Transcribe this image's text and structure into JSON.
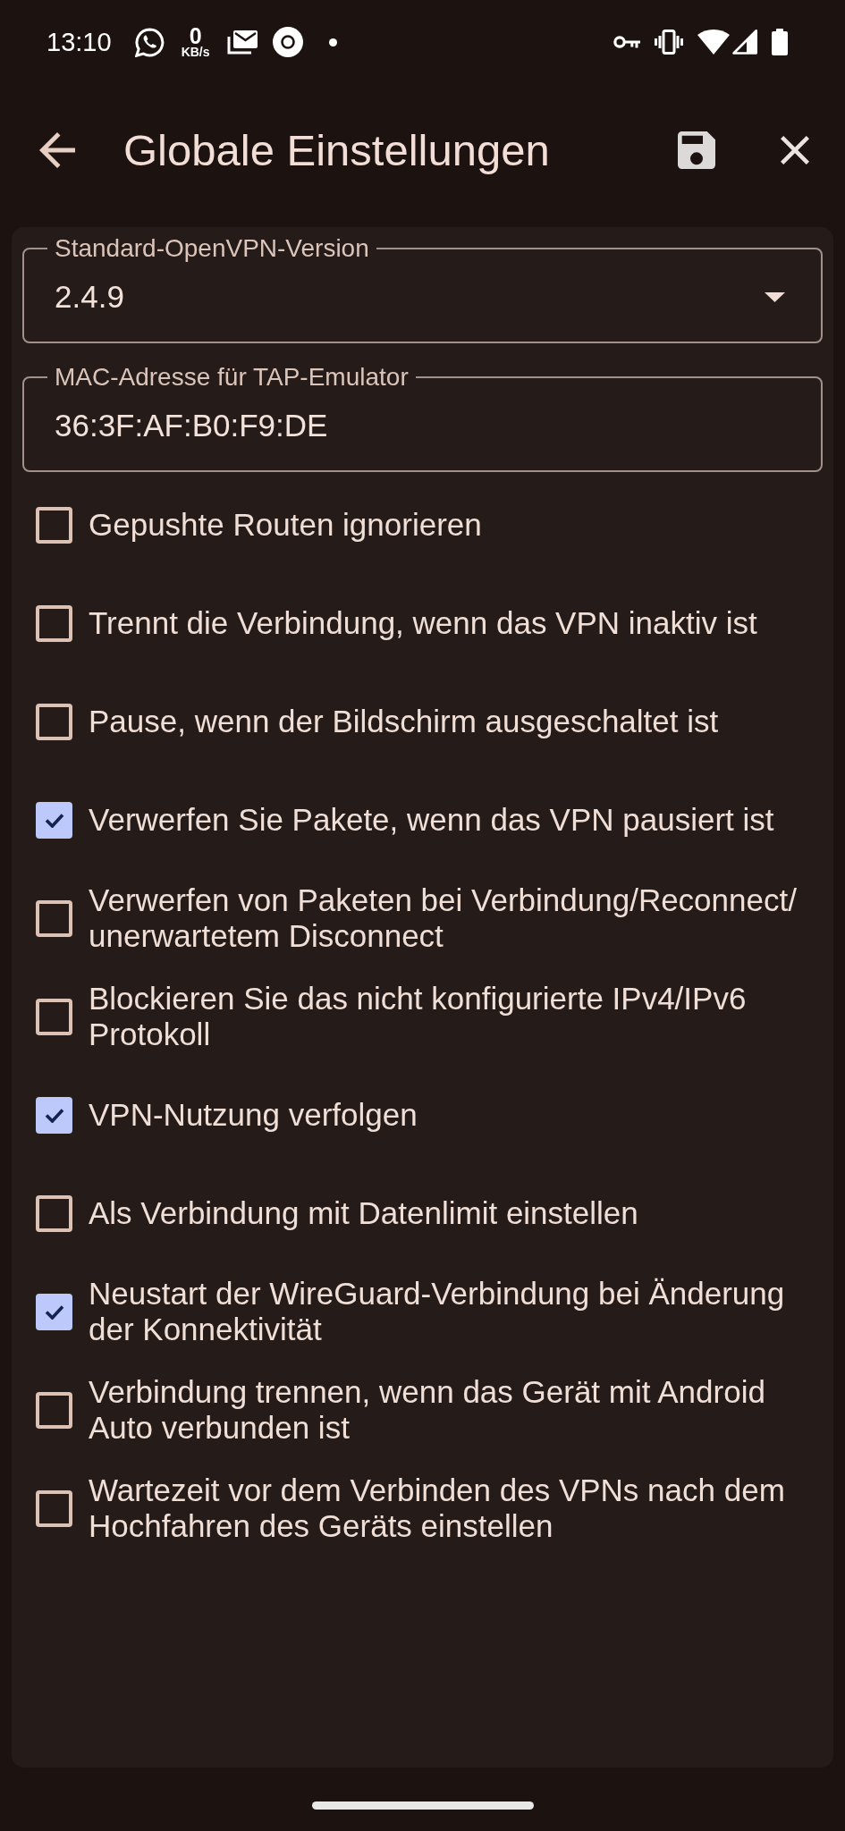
{
  "status_bar": {
    "time": "13:10",
    "network_speed": {
      "value": "0",
      "unit": "KB/s"
    }
  },
  "app_bar": {
    "title": "Globale Einstellungen"
  },
  "fields": [
    {
      "kind": "dropdown",
      "label": "Standard-OpenVPN-Version",
      "value": "2.4.9"
    },
    {
      "kind": "text",
      "label": "MAC-Adresse für TAP-Emulator",
      "value": "36:3F:AF:B0:F9:DE"
    }
  ],
  "options": [
    {
      "label": "Gepushte Routen ignorieren",
      "checked": false
    },
    {
      "label": "Trennt die Verbindung, wenn das VPN inaktiv ist",
      "checked": false
    },
    {
      "label": "Pause, wenn der Bildschirm ausgeschaltet ist",
      "checked": false
    },
    {
      "label": "Verwerfen Sie Pakete, wenn das VPN pausiert ist",
      "checked": true
    },
    {
      "label": "Verwerfen von Paketen bei Verbindung/Reconnect/ unerwartetem Disconnect",
      "checked": false
    },
    {
      "label": "Blockieren Sie das nicht konfigurierte IPv4/IPv6 Protokoll",
      "checked": false
    },
    {
      "label": "VPN-Nutzung verfolgen",
      "checked": true
    },
    {
      "label": "Als Verbindung mit Datenlimit einstellen",
      "checked": false
    },
    {
      "label": "Neustart der WireGuard-Verbindung bei Änderung der Konnektivität",
      "checked": true
    },
    {
      "label": "Verbindung trennen, wenn das Gerät mit Android Auto verbunden ist",
      "checked": false
    },
    {
      "label": "Wartezeit vor dem Verbinden des VPNs nach dem Hochfahren des Geräts einstellen",
      "checked": false
    }
  ]
}
